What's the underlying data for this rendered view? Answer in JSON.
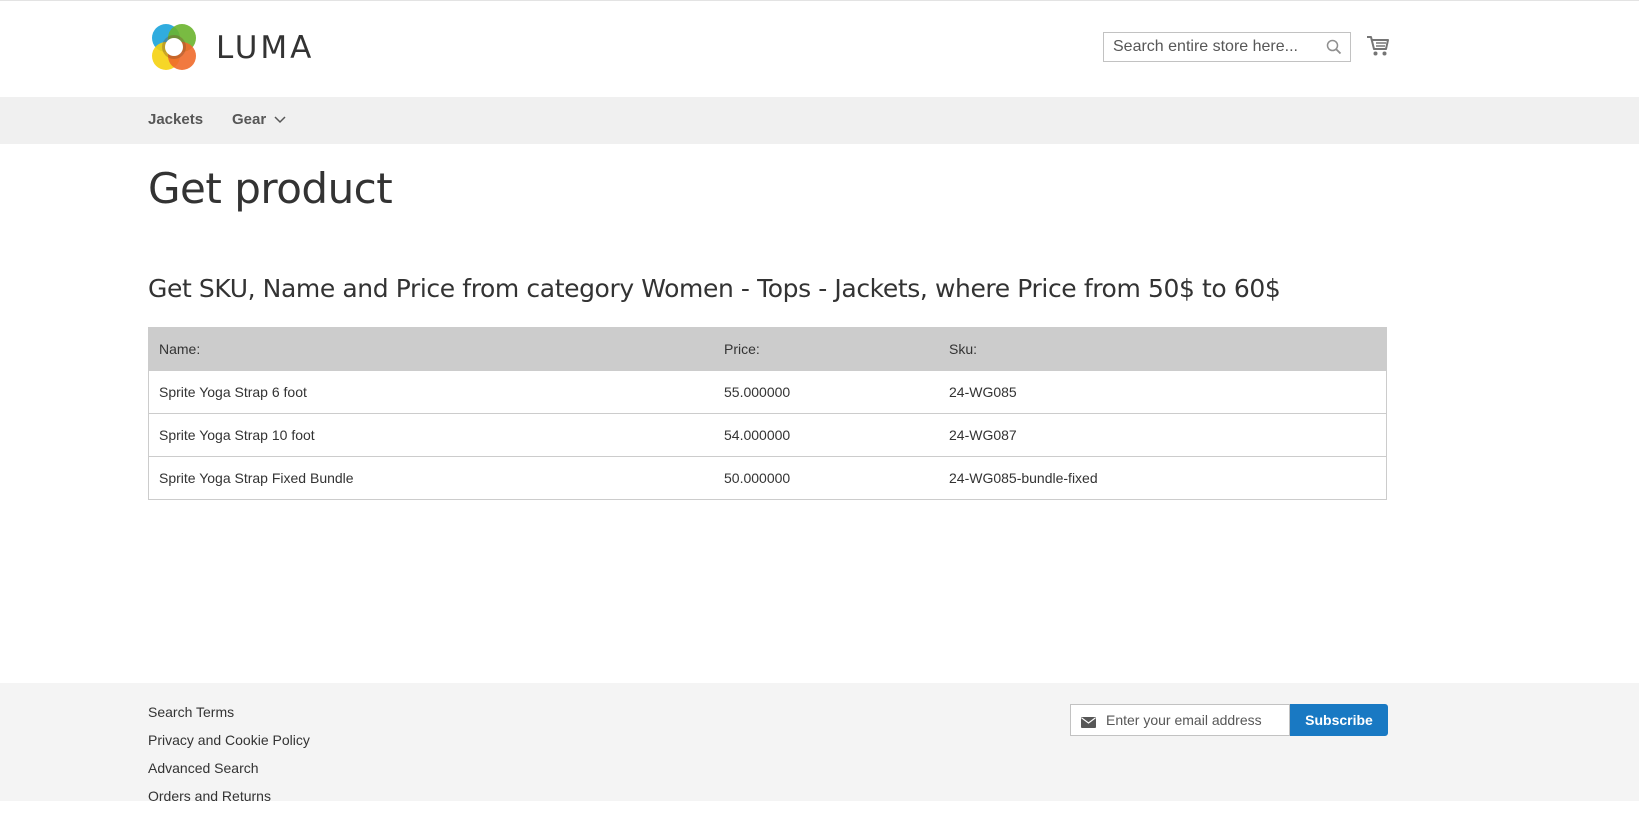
{
  "header": {
    "logo_text": "LUMA",
    "search": {
      "placeholder": "Search entire store here...",
      "value": ""
    }
  },
  "nav": {
    "items": [
      {
        "label": "Jackets"
      },
      {
        "label": "Gear"
      }
    ]
  },
  "main": {
    "title": "Get product",
    "subtitle": "Get SKU, Name and Price from category Women - Tops - Jackets, where Price from 50$ to 60$",
    "table": {
      "headers": [
        "Name:",
        "Price:",
        "Sku:"
      ],
      "rows": [
        [
          "Sprite Yoga Strap 6 foot",
          "55.000000",
          "24-WG085"
        ],
        [
          "Sprite Yoga Strap 10 foot",
          "54.000000",
          "24-WG087"
        ],
        [
          "Sprite Yoga Strap Fixed Bundle",
          "50.000000",
          "24-WG085-bundle-fixed"
        ]
      ]
    }
  },
  "footer": {
    "links": [
      "Search Terms",
      "Privacy and Cookie Policy",
      "Advanced Search",
      "Orders and Returns"
    ],
    "newsletter": {
      "placeholder": "Enter your email address",
      "button_label": "Subscribe"
    }
  },
  "colors": {
    "accent": "#1979c3",
    "nav_bg": "#f0f0f0",
    "table_header_bg": "#cccccc",
    "footer_bg": "#f4f4f4"
  }
}
